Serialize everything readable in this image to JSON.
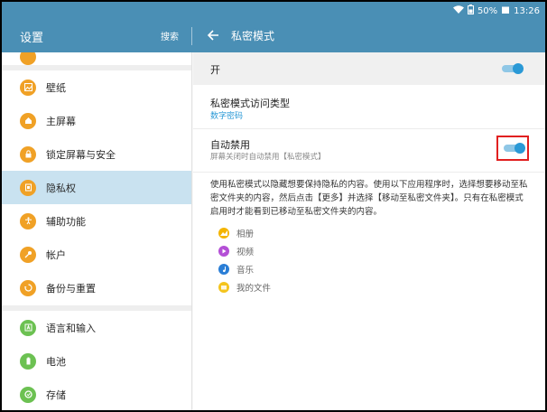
{
  "status_bar": {
    "battery": "50%",
    "time": "13:26"
  },
  "left_panel": {
    "title": "设置",
    "search_label": "搜索",
    "items": [
      {
        "label": "壁纸",
        "icon": "wallpaper-icon",
        "color": "#f0a126"
      },
      {
        "label": "主屏幕",
        "icon": "home-icon",
        "color": "#f0a126"
      },
      {
        "label": "锁定屏幕与安全",
        "icon": "lock-icon",
        "color": "#f0a126"
      },
      {
        "label": "隐私权",
        "icon": "privacy-icon",
        "color": "#f0a126",
        "selected": true
      },
      {
        "label": "辅助功能",
        "icon": "accessibility-icon",
        "color": "#f0a126"
      },
      {
        "label": "帐户",
        "icon": "key-icon",
        "color": "#f0a126"
      },
      {
        "label": "备份与重置",
        "icon": "backup-icon",
        "color": "#f0a126"
      },
      {
        "label": "语言和输入",
        "icon": "language-icon",
        "color": "#6cc152"
      },
      {
        "label": "电池",
        "icon": "battery-icon",
        "color": "#6cc152"
      },
      {
        "label": "存储",
        "icon": "storage-icon",
        "color": "#6cc152"
      }
    ]
  },
  "right_panel": {
    "title": "私密模式",
    "master_switch": {
      "label": "开",
      "on": true
    },
    "access_type": {
      "title": "私密模式访问类型",
      "value": "数字密码"
    },
    "auto_disable": {
      "title": "自动禁用",
      "subtitle": "屏幕关闭时自动禁用【私密模式】",
      "on": true
    },
    "description": "使用私密模式以隐藏想要保持隐私的内容。使用以下应用程序时，选择想要移动至私密文件夹的内容，然后点击【更多】并选择【移动至私密文件夹】。只有在私密模式启用时才能看到已移动至私密文件夹的内容。",
    "apps": [
      {
        "label": "相册",
        "icon": "gallery-icon",
        "color": "#f4b400"
      },
      {
        "label": "视频",
        "icon": "video-icon",
        "color": "#b44fd6"
      },
      {
        "label": "音乐",
        "icon": "music-icon",
        "color": "#2a7ed6"
      },
      {
        "label": "我的文件",
        "icon": "folder-icon",
        "color": "#f4c41d"
      }
    ]
  },
  "colors": {
    "accent": "#4a8fb5",
    "toggle": "#2a99d6",
    "highlight": "#e12020",
    "selected_row": "#c9e2f0"
  }
}
